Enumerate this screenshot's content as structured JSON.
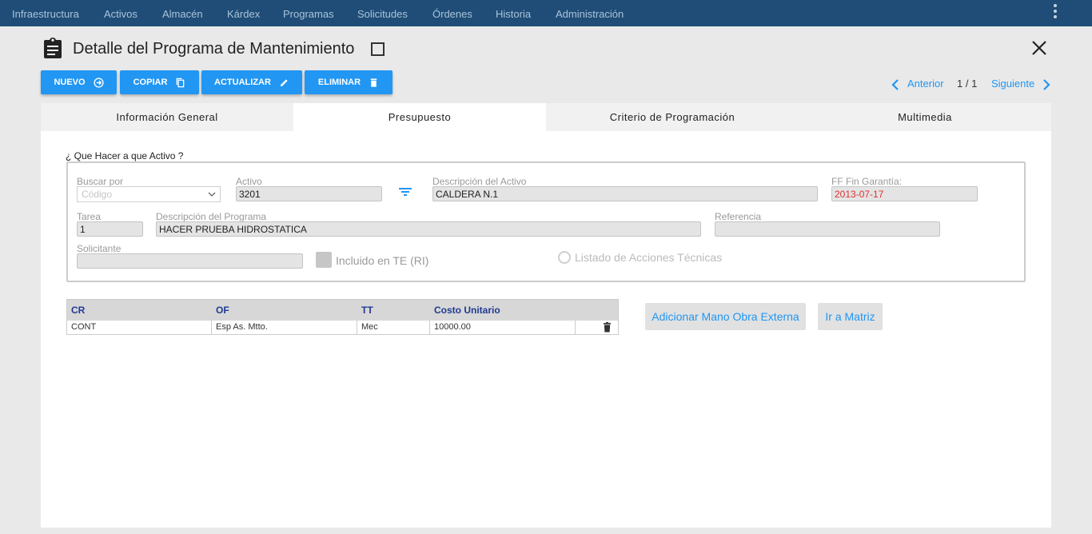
{
  "nav": {
    "items": [
      "Infraestructura",
      "Activos",
      "Almacén",
      "Kárdex",
      "Programas",
      "Solicitudes",
      "Órdenes",
      "Historia",
      "Administración"
    ],
    "bg_color": "#1f4d77"
  },
  "header": {
    "title": "Detalle del Programa de Mantenimiento",
    "icon": "clipboard-icon"
  },
  "toolbar": {
    "nuevo": "NUEVO",
    "copiar": "COPIAR",
    "actualizar": "ACTUALIZAR",
    "eliminar": "ELIMINAR",
    "accent": "#2196f3"
  },
  "pager": {
    "prev": "Anterior",
    "count": "1 / 1",
    "next": "Siguiente"
  },
  "tabs": [
    {
      "label": "Información General",
      "active": false
    },
    {
      "label": "Presupuesto",
      "active": true
    },
    {
      "label": "Criterio de Programación",
      "active": false
    },
    {
      "label": "Multimedia",
      "active": false
    }
  ],
  "form": {
    "legend": "¿ Que Hacer a que Activo ?",
    "buscar_por": {
      "label": "Buscar por",
      "value": "Código"
    },
    "activo": {
      "label": "Activo",
      "value": "3201"
    },
    "desc_activo": {
      "label": "Descripción del Activo",
      "value": "CALDERA N.1"
    },
    "ff_garantia": {
      "label": "FF Fin Garantía:",
      "value": "2013-07-17"
    },
    "tarea": {
      "label": "Tarea",
      "value": "1"
    },
    "desc_programa": {
      "label": "Descripción del Programa",
      "value": "HACER PRUEBA HIDROSTATICA"
    },
    "referencia": {
      "label": "Referencia",
      "value": ""
    },
    "solicitante": {
      "label": "Solicitante",
      "value": ""
    },
    "incluido_te": {
      "label": "Incluido en TE (RI)",
      "checked": false
    },
    "listado_acciones": {
      "label": "Listado de Acciones Técnicas",
      "selected": false
    }
  },
  "table": {
    "headers": [
      "CR",
      "OF",
      "TT",
      "Costo Unitario"
    ],
    "rows": [
      [
        "CONT",
        "Esp As. Mtto.",
        "Mec",
        "10000.00"
      ]
    ]
  },
  "actions": {
    "mano_obra": "Adicionar Mano Obra Externa",
    "matriz": "Ir a Matriz"
  }
}
